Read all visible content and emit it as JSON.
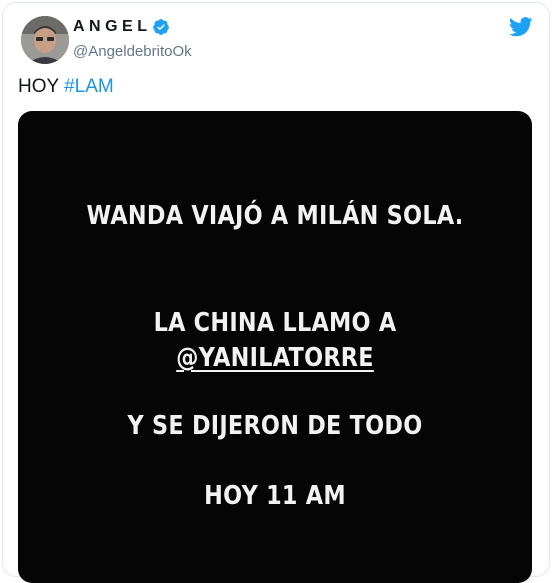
{
  "author": {
    "name": "ANGEL",
    "handle": "@AngeldebritoOk"
  },
  "tweet": {
    "text_prefix": "HOY ",
    "hashtag": "#LAM"
  },
  "story": {
    "line1": "WANDA VIAJÓ A MILÁN SOLA.",
    "line2": "LA CHINA LLAMO A",
    "line3": "@YANILATORRE",
    "line4": "Y SE DIJERON DE TODO",
    "line5": "HOY 11 AM"
  },
  "colors": {
    "twitter_blue": "#1da1f2",
    "hashtag": "#1b95e0",
    "media_bg": "#050505"
  },
  "icons": [
    "verified-badge-icon",
    "twitter-bird-icon"
  ]
}
